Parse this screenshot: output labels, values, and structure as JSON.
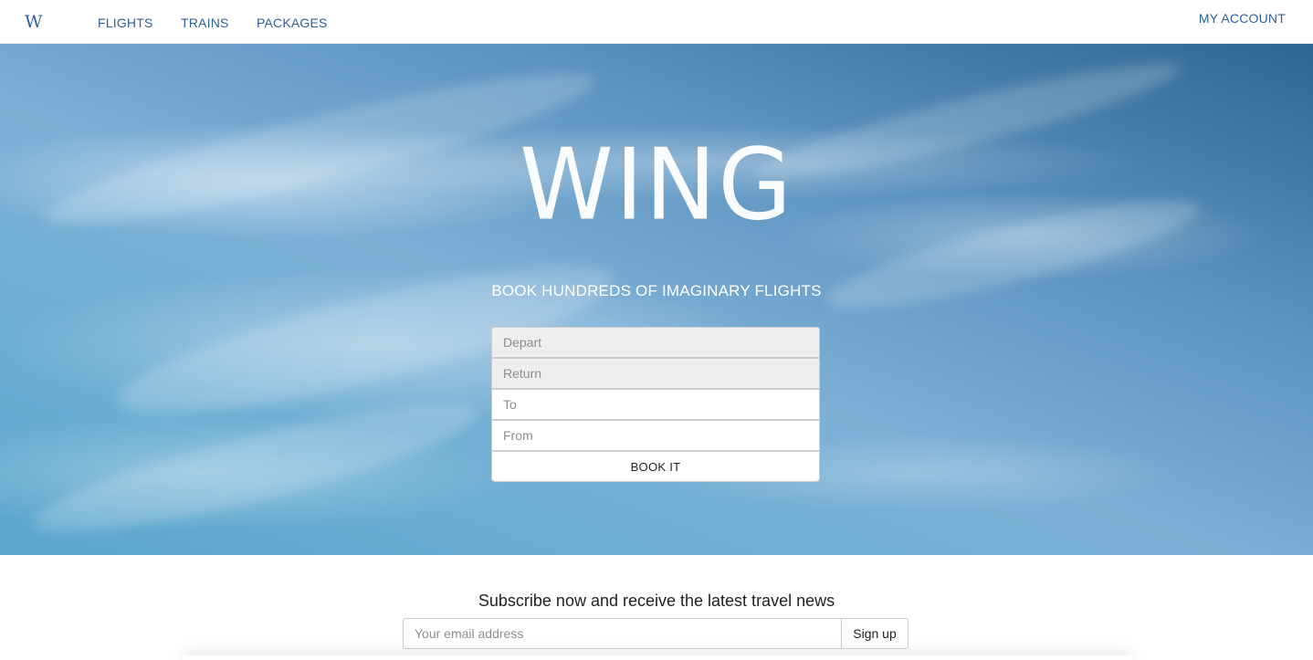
{
  "nav": {
    "brand": "W",
    "links": [
      "FLIGHTS",
      "TRAINS",
      "PACKAGES"
    ],
    "account": "MY ACCOUNT"
  },
  "hero": {
    "title": "WING",
    "subtitle": "BOOK HUNDREDS OF IMAGINARY FLIGHTS",
    "form": {
      "depart_placeholder": "Depart",
      "return_placeholder": "Return",
      "to_placeholder": "To",
      "from_placeholder": "From",
      "submit_label": "BOOK IT"
    }
  },
  "subscribe": {
    "title": "Subscribe now and receive the latest travel news",
    "email_placeholder": "Your email address",
    "button_label": "Sign up"
  },
  "colors": {
    "nav_text": "#2d5f99",
    "sky": "#6caed2"
  }
}
